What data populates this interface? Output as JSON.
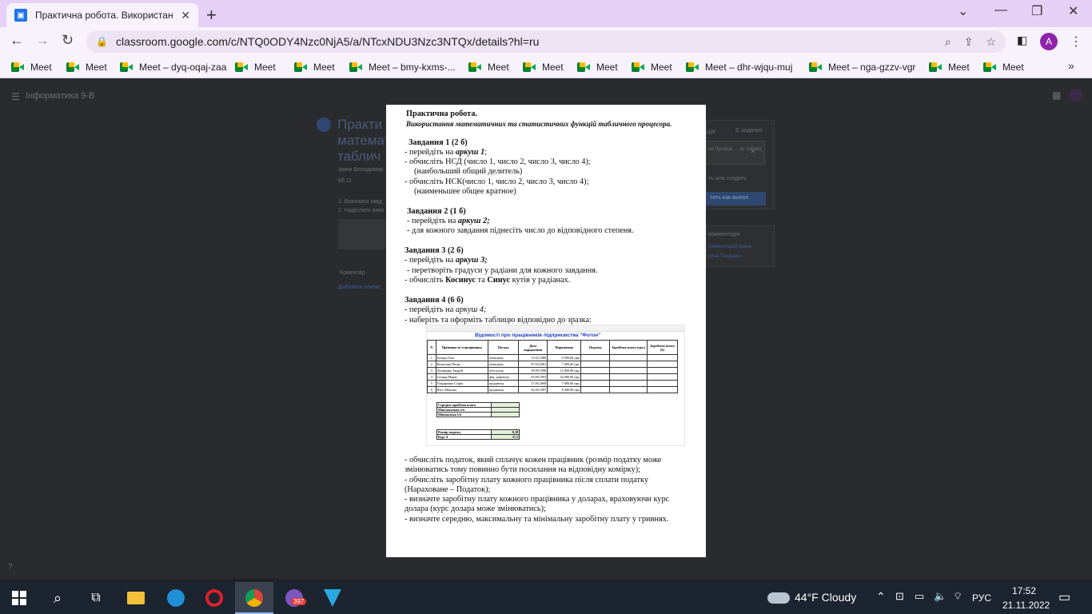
{
  "browser": {
    "tab_title": "Практична робота. Використан",
    "url": "classroom.google.com/c/NTQ0ODY4Nzc0NjA5/a/NTcxNDU3Nzc3NTQx/details?hl=ru",
    "avatar_letter": "A"
  },
  "bookmarks": [
    "Meet",
    "Meet",
    "Meet – dyq-oqaj-zaa",
    "Meet",
    "Meet",
    "Meet – bmy-kxms-...",
    "Meet",
    "Meet",
    "Meet",
    "Meet",
    "Meet – dhr-wjqu-muj",
    "Meet – nga-gzzv-vgr",
    "Meet",
    "Meet"
  ],
  "classroom": {
    "class_name": "Інформатика 9-В",
    "assignment_title_lines": [
      "Практи",
      "математ",
      "таблич"
    ],
    "teacher": "Ірина Володимир",
    "points": "6б 11",
    "list_items": [
      "1. Виконати завд",
      "2. Надіслати вико"
    ],
    "comments_label": "Коментар",
    "add_comment": "Добавить комме",
    "right_panel": {
      "your_work": "ція",
      "status": "Є задания",
      "file_chip": "ня Луговая ... ли таблиц",
      "add_create": "ть или создать",
      "mark_done": "тить как выпол",
      "private_comments": "комментари",
      "private_comment_link1": "комментарий Ірина",
      "private_comment_link2": "рина Тенденко"
    }
  },
  "document": {
    "title": "Практична робота.",
    "subtitle": "Використання математичних та статистичних функцій табличного процесора.",
    "task1": {
      "heading": "Завдання 1 (2 б)",
      "l1_pre": "-   перейдіть на ",
      "l1_bold": "аркуш 1",
      "l1_post": ";",
      "l2": "-   обчисліть НСД (число 1, число 2, число 3, число 4);",
      "l3": "(наибольший общий делитель)",
      "l4": "-   обчисліть НСК(число 1, число 2, число 3, число 4);",
      "l5": "(наименьшее общее кратное)"
    },
    "task2": {
      "heading": "Завдання 2 (1 б)",
      "l1_pre": "- перейдіть на ",
      "l1_bold": "аркуш 2;",
      "l2": "- для кожного завдання піднесіть число до відповідного степеня."
    },
    "task3": {
      "heading": "Завдання 3 (2 б)",
      "l1_pre": "- перейдіть на ",
      "l1_bold": "аркуш 3;",
      "l2": "- перетворіть градуси у радіани для кожного завдання.",
      "l3_pre": "- обчисліть ",
      "l3_b1": "Косинус",
      "l3_mid": "  та ",
      "l3_b2": "Синус",
      "l3_post": " кутів  у радіанах."
    },
    "task4": {
      "heading": "Завдання 4 (6 б)",
      "l1_pre": "- перейдіть на ",
      "l1_it": "аркуш 4;",
      "l2": "- наберіть та оформіть таблицю відповідно до зразка:"
    },
    "bottom": [
      "-   обчисліть  податок, який сплачує кожен працівник (розмір податку може",
      "    змінюватись тому повинно бути посилання на відповідну комірку);",
      "-   обчисліть заробітну плату кожного працівника після сплати податку",
      "    (Нараховане – Податок);",
      "-   визначте заробітну плату кожного працівника у доларах, враховуючи курс",
      "    долара (курс долара може змінюватись);",
      "-    визначте середню, максимальну та мінімальну заробітну плату у гривнях."
    ]
  },
  "sheet": {
    "title": "Відомості про працівників підприємства \"Фотон\"",
    "headers": [
      "N",
      "Прізвище ім'я працівника",
      "Посада",
      "Дата народження",
      "Нараховано",
      "Податок",
      "Заробітна плата (грн.)",
      "Заробітна плата ($)"
    ],
    "rows": [
      [
        "1",
        "Баляда Олег",
        "менеджер",
        "13.02.1989",
        "9 500,00 грн."
      ],
      [
        "2",
        "Колисник Петро",
        "менеджер",
        "07.04.2001",
        "7 800,00 грн."
      ],
      [
        "3",
        "Лазаренко Андрій",
        "бухгалтер",
        "18.09.1998",
        "12 000,00 грн."
      ],
      [
        "4",
        "Сичкар Марія",
        "фін. директор",
        "03.08.1993",
        "34 000,00 грн."
      ],
      [
        "5",
        "Тендаренко Софія",
        "продавець",
        "27.06.2000",
        "7 800,00 грн."
      ],
      [
        "6",
        "Ятух Максим",
        "продавець",
        "26.08.1997",
        "8 400,00 грн."
      ]
    ],
    "stats": [
      "Середня заробітна плата",
      "Максимальна з/п",
      "Мінімальна з/п"
    ],
    "tax_label": "Розмір податку",
    "tax_value": "0,18",
    "rate_label": "Курс $",
    "rate_value": "37,3"
  },
  "taskbar": {
    "weather": "44°F  Cloudy",
    "lang": "РУС",
    "time": "17:52",
    "date": "21.11.2022",
    "viber_badge": "397"
  }
}
